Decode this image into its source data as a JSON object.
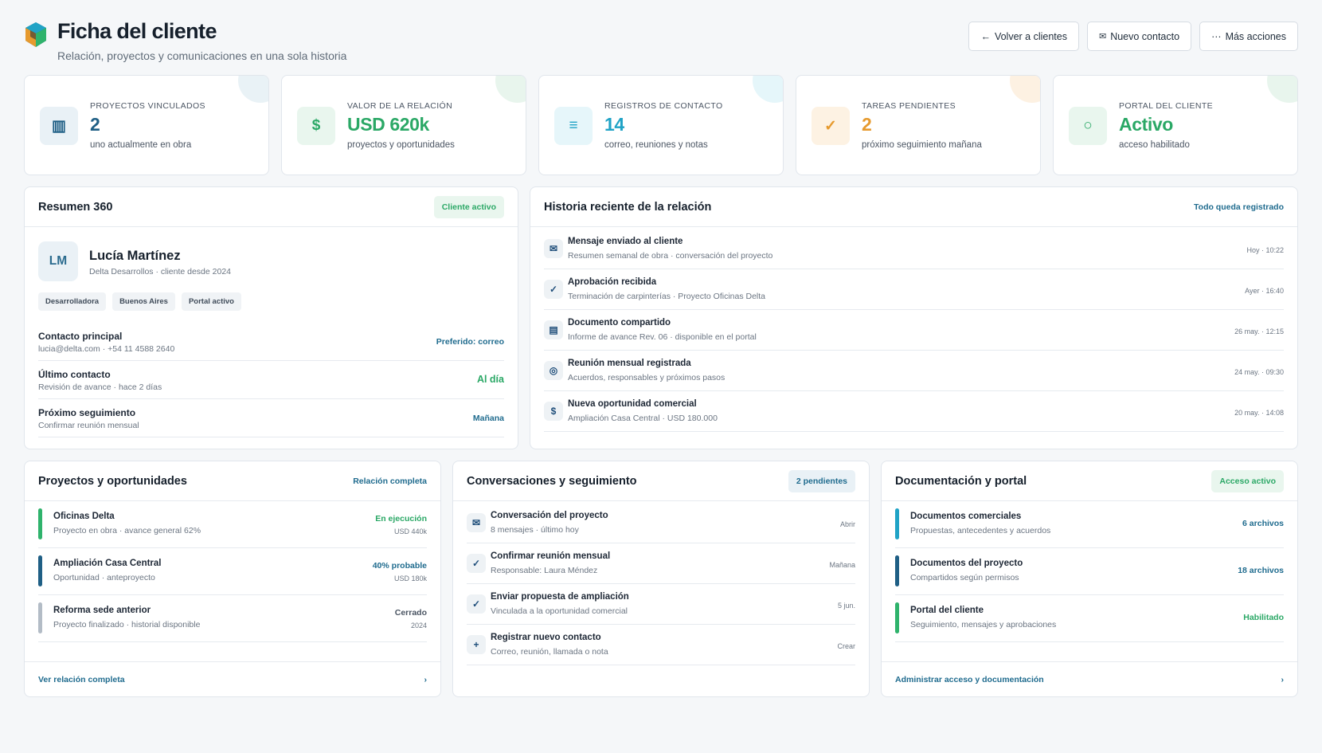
{
  "header": {
    "title": "Ficha del cliente",
    "subtitle": "Relación, proyectos y comunicaciones en una sola historia",
    "buttons": [
      {
        "icon": "arrow-left-icon",
        "glyph": "←",
        "label": "Volver a clientes"
      },
      {
        "icon": "mail-icon",
        "glyph": "✉",
        "label": "Nuevo contacto"
      },
      {
        "icon": "ellipsis-icon",
        "glyph": "···",
        "label": "Más acciones"
      }
    ]
  },
  "kpis": [
    {
      "label": "PROYECTOS VINCULADOS",
      "value": "2",
      "sub": "uno actualmente en obra",
      "glyph": "▥",
      "icon": "projects-icon",
      "color": "#1f5f85",
      "bg": "#e9f1f6",
      "blob": "#e9f2f6"
    },
    {
      "label": "VALOR DE LA RELACIÓN",
      "value": "USD 620k",
      "sub": "proyectos y oportunidades",
      "glyph": "$",
      "icon": "dollar-icon",
      "color": "#2ba866",
      "bg": "#e9f6ee",
      "blob": "#e8f5ed"
    },
    {
      "label": "REGISTROS DE CONTACTO",
      "value": "14",
      "sub": "correo, reuniones y notas",
      "glyph": "≡",
      "icon": "list-icon",
      "color": "#20a3c6",
      "bg": "#e6f6fa",
      "blob": "#e5f6fa"
    },
    {
      "label": "TAREAS PENDIENTES",
      "value": "2",
      "sub": "próximo seguimiento mañana",
      "glyph": "✓",
      "icon": "check-icon",
      "color": "#e69a2e",
      "bg": "#fdf2e3",
      "blob": "#fdf1e2"
    },
    {
      "label": "PORTAL DEL CLIENTE",
      "value": "Activo",
      "sub": "acceso habilitado",
      "glyph": "○",
      "icon": "portal-icon",
      "color": "#2ba866",
      "bg": "#e9f6ee",
      "blob": "#e8f5ed"
    }
  ],
  "summary": {
    "title": "Resumen 360",
    "badge": "Cliente activo",
    "avatar": "LM",
    "name": "Lucía Martínez",
    "meta": "Delta Desarrollos · cliente desde 2024",
    "tags": [
      "Desarrolladora",
      "Buenos Aires",
      "Portal activo"
    ],
    "rows": [
      {
        "title": "Contacto principal",
        "sub": "lucia@delta.com · +54 11 4588 2640",
        "right": "Preferido: correo",
        "color": "#1f6b8e"
      },
      {
        "title": "Último contacto",
        "sub": "Revisión de avance · hace 2 días",
        "right": "Al día",
        "color": "#2ba866"
      },
      {
        "title": "Próximo seguimiento",
        "sub": "Confirmar reunión mensual",
        "right": "Mañana",
        "color": "#1f6b8e"
      }
    ]
  },
  "history": {
    "title": "Historia reciente de la relación",
    "link": "Todo queda registrado",
    "items": [
      {
        "glyph": "✉",
        "icon": "mail-icon",
        "title": "Mensaje enviado al cliente",
        "sub": "Resumen semanal de obra · conversación del proyecto",
        "time": "Hoy · 10:22"
      },
      {
        "glyph": "✓",
        "icon": "check-icon",
        "title": "Aprobación recibida",
        "sub": "Terminación de carpinterías · Proyecto Oficinas Delta",
        "time": "Ayer · 16:40"
      },
      {
        "glyph": "▤",
        "icon": "document-icon",
        "title": "Documento compartido",
        "sub": "Informe de avance Rev. 06 · disponible en el portal",
        "time": "26 may. · 12:15"
      },
      {
        "glyph": "◎",
        "icon": "meeting-icon",
        "title": "Reunión mensual registrada",
        "sub": "Acuerdos, responsables y próximos pasos",
        "time": "24 may. · 09:30"
      },
      {
        "glyph": "$",
        "icon": "dollar-icon",
        "title": "Nueva oportunidad comercial",
        "sub": "Ampliación Casa Central · USD 180.000",
        "time": "20 may. · 14:08"
      }
    ]
  },
  "projects": {
    "title": "Proyectos y oportunidades",
    "link": "Relación completa",
    "items": [
      {
        "title": "Oficinas Delta",
        "sub": "Proyecto en obra · avance general 62%",
        "status": "En ejecución",
        "amount": "USD 440k",
        "bar": "#2fb36c",
        "scolor": "#2ba866"
      },
      {
        "title": "Ampliación Casa Central",
        "sub": "Oportunidad · anteproyecto",
        "status": "40% probable",
        "amount": "USD 180k",
        "bar": "#1f5f85",
        "scolor": "#1f6b8e"
      },
      {
        "title": "Reforma sede anterior",
        "sub": "Proyecto finalizado · historial disponible",
        "status": "Cerrado",
        "amount": "2024",
        "bar": "#b3bcc6",
        "scolor": "#4b5563"
      }
    ],
    "footer": "Ver relación completa"
  },
  "conversations": {
    "title": "Conversaciones y seguimiento",
    "badge": "2 pendientes",
    "items": [
      {
        "glyph": "✉",
        "icon": "mail-icon",
        "title": "Conversación del proyecto",
        "sub": "8 mensajes · último hoy",
        "action": "Abrir"
      },
      {
        "glyph": "✓",
        "icon": "check-icon",
        "title": "Confirmar reunión mensual",
        "sub": "Responsable: Laura Méndez",
        "action": "Mañana"
      },
      {
        "glyph": "✓",
        "icon": "check-icon",
        "title": "Enviar propuesta de ampliación",
        "sub": "Vinculada a la oportunidad comercial",
        "action": "5 jun."
      },
      {
        "glyph": "+",
        "icon": "plus-icon",
        "title": "Registrar nuevo contacto",
        "sub": "Correo, reunión, llamada o nota",
        "action": "Crear"
      }
    ]
  },
  "documents": {
    "title": "Documentación y portal",
    "badge": "Acceso activo",
    "items": [
      {
        "title": "Documentos comerciales",
        "sub": "Propuestas, antecedentes y acuerdos",
        "status": "6 archivos",
        "bar": "#20a3c6",
        "scolor": "#1f6b8e"
      },
      {
        "title": "Documentos del proyecto",
        "sub": "Compartidos según permisos",
        "status": "18 archivos",
        "bar": "#1f5f85",
        "scolor": "#1f6b8e"
      },
      {
        "title": "Portal del cliente",
        "sub": "Seguimiento, mensajes y aprobaciones",
        "status": "Habilitado",
        "bar": "#2fb36c",
        "scolor": "#2ba866"
      }
    ],
    "footer": "Administrar acceso y documentación"
  },
  "footer_chevron": "›"
}
